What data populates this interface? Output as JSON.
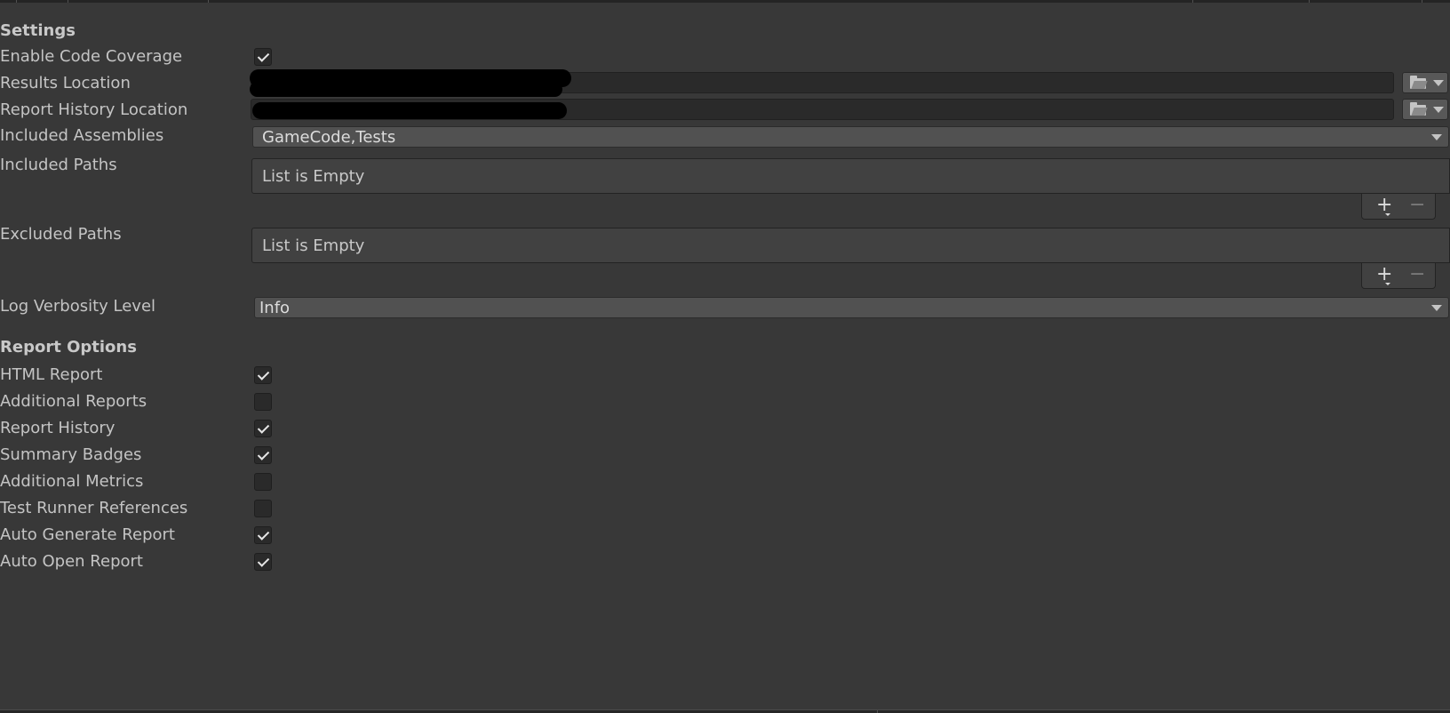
{
  "settings": {
    "section_title": "Settings",
    "enable_code_coverage": {
      "label": "Enable Code Coverage",
      "checked": true
    },
    "results_location": {
      "label": "Results Location",
      "value": ""
    },
    "report_history_location": {
      "label": "Report History Location",
      "value": ""
    },
    "included_assemblies": {
      "label": "Included Assemblies",
      "value": "GameCode,Tests"
    },
    "included_paths": {
      "label": "Included Paths",
      "empty_text": "List is Empty"
    },
    "excluded_paths": {
      "label": "Excluded Paths",
      "empty_text": "List is Empty"
    },
    "log_verbosity": {
      "label": "Log Verbosity Level",
      "value": "Info"
    }
  },
  "report_options": {
    "section_title": "Report Options",
    "items": [
      {
        "label": "HTML Report",
        "checked": true
      },
      {
        "label": "Additional Reports",
        "checked": false
      },
      {
        "label": "Report History",
        "checked": true
      },
      {
        "label": "Summary Badges",
        "checked": true
      },
      {
        "label": "Additional Metrics",
        "checked": false
      },
      {
        "label": "Test Runner References",
        "checked": false
      },
      {
        "label": "Auto Generate Report",
        "checked": true
      },
      {
        "label": "Auto Open Report",
        "checked": true
      }
    ]
  },
  "icons": {
    "folder": "folder-icon",
    "dropdown": "caret-down-icon",
    "add": "plus-icon",
    "remove": "minus-icon",
    "check": "checkmark-icon"
  },
  "colors": {
    "background": "#383838",
    "field": "#2a2a2a",
    "dropdown": "#515151",
    "text": "#c4c4c4"
  }
}
